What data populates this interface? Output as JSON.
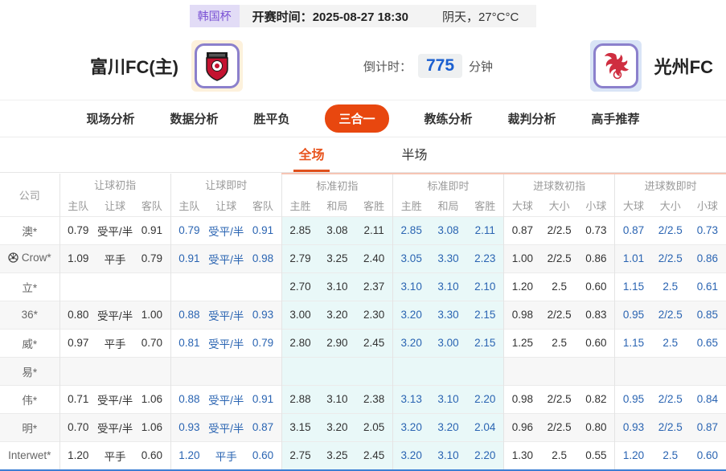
{
  "topbar": {
    "league": "韩国杯",
    "kickoff_label": "开赛时间：",
    "kickoff_time": "2025-08-27 18:30",
    "weather": "阴天，27°C°C"
  },
  "header": {
    "home_name": "富川FC(主)",
    "away_name": "光州FC",
    "countdown_label": "倒计时：",
    "countdown_value": "775",
    "countdown_unit": "分钟"
  },
  "nav": {
    "tabs": [
      {
        "label": "现场分析",
        "active": false
      },
      {
        "label": "数据分析",
        "active": false
      },
      {
        "label": "胜平负",
        "active": false
      },
      {
        "label": "三合一",
        "active": true
      },
      {
        "label": "教练分析",
        "active": false
      },
      {
        "label": "裁判分析",
        "active": false
      },
      {
        "label": "高手推荐",
        "active": false
      }
    ]
  },
  "subtabs": [
    {
      "label": "全场",
      "active": true
    },
    {
      "label": "半场",
      "active": false
    }
  ],
  "table": {
    "company_header": "公司",
    "groups": [
      {
        "title": "让球初指",
        "cols": [
          "主队",
          "让球",
          "客队"
        ],
        "live": false,
        "cyan": false,
        "hot": false
      },
      {
        "title": "让球即时",
        "cols": [
          "主队",
          "让球",
          "客队"
        ],
        "live": true,
        "cyan": false,
        "hot": false
      },
      {
        "title": "标准初指",
        "cols": [
          "主胜",
          "和局",
          "客胜"
        ],
        "live": false,
        "cyan": true,
        "hot": true
      },
      {
        "title": "标准即时",
        "cols": [
          "主胜",
          "和局",
          "客胜"
        ],
        "live": true,
        "cyan": true,
        "hot": true
      },
      {
        "title": "进球数初指",
        "cols": [
          "大球",
          "大小",
          "小球"
        ],
        "live": false,
        "cyan": false,
        "hot": true
      },
      {
        "title": "进球数即时",
        "cols": [
          "大球",
          "大小",
          "小球"
        ],
        "live": true,
        "cyan": false,
        "hot": true
      }
    ],
    "rows": [
      {
        "company": "澳*",
        "has_icon": false,
        "cells": [
          [
            "0.79",
            "受平/半",
            "0.91"
          ],
          [
            "0.79",
            "受平/半",
            "0.91"
          ],
          [
            "2.85",
            "3.08",
            "2.11"
          ],
          [
            "2.85",
            "3.08",
            "2.11"
          ],
          [
            "0.87",
            "2/2.5",
            "0.73"
          ],
          [
            "0.87",
            "2/2.5",
            "0.73"
          ]
        ]
      },
      {
        "company": "Crow*",
        "has_icon": true,
        "cells": [
          [
            "1.09",
            "平手",
            "0.79"
          ],
          [
            "0.91",
            "受平/半",
            "0.98"
          ],
          [
            "2.79",
            "3.25",
            "2.40"
          ],
          [
            "3.05",
            "3.30",
            "2.23"
          ],
          [
            "1.00",
            "2/2.5",
            "0.86"
          ],
          [
            "1.01",
            "2/2.5",
            "0.86"
          ]
        ]
      },
      {
        "company": "立*",
        "has_icon": false,
        "cells": [
          [
            "",
            "",
            ""
          ],
          [
            "",
            "",
            ""
          ],
          [
            "2.70",
            "3.10",
            "2.37"
          ],
          [
            "3.10",
            "3.10",
            "2.10"
          ],
          [
            "1.20",
            "2.5",
            "0.60"
          ],
          [
            "1.15",
            "2.5",
            "0.61"
          ]
        ]
      },
      {
        "company": "36*",
        "has_icon": false,
        "cells": [
          [
            "0.80",
            "受平/半",
            "1.00"
          ],
          [
            "0.88",
            "受平/半",
            "0.93"
          ],
          [
            "3.00",
            "3.20",
            "2.30"
          ],
          [
            "3.20",
            "3.30",
            "2.15"
          ],
          [
            "0.98",
            "2/2.5",
            "0.83"
          ],
          [
            "0.95",
            "2/2.5",
            "0.85"
          ]
        ]
      },
      {
        "company": "威*",
        "has_icon": false,
        "cells": [
          [
            "0.97",
            "平手",
            "0.70"
          ],
          [
            "0.81",
            "受平/半",
            "0.79"
          ],
          [
            "2.80",
            "2.90",
            "2.45"
          ],
          [
            "3.20",
            "3.00",
            "2.15"
          ],
          [
            "1.25",
            "2.5",
            "0.60"
          ],
          [
            "1.15",
            "2.5",
            "0.65"
          ]
        ]
      },
      {
        "company": "易*",
        "has_icon": false,
        "cells": [
          [
            "",
            "",
            ""
          ],
          [
            "",
            "",
            ""
          ],
          [
            "",
            "",
            ""
          ],
          [
            "",
            "",
            ""
          ],
          [
            "",
            "",
            ""
          ],
          [
            "",
            "",
            ""
          ]
        ]
      },
      {
        "company": "伟*",
        "has_icon": false,
        "cells": [
          [
            "0.71",
            "受平/半",
            "1.06"
          ],
          [
            "0.88",
            "受平/半",
            "0.91"
          ],
          [
            "2.88",
            "3.10",
            "2.38"
          ],
          [
            "3.13",
            "3.10",
            "2.20"
          ],
          [
            "0.98",
            "2/2.5",
            "0.82"
          ],
          [
            "0.95",
            "2/2.5",
            "0.84"
          ]
        ]
      },
      {
        "company": "明*",
        "has_icon": false,
        "cells": [
          [
            "0.70",
            "受平/半",
            "1.06"
          ],
          [
            "0.93",
            "受平/半",
            "0.87"
          ],
          [
            "3.15",
            "3.20",
            "2.05"
          ],
          [
            "3.20",
            "3.20",
            "2.04"
          ],
          [
            "0.96",
            "2/2.5",
            "0.80"
          ],
          [
            "0.93",
            "2/2.5",
            "0.87"
          ]
        ]
      },
      {
        "company": "Interwet*",
        "has_icon": false,
        "cells": [
          [
            "1.20",
            "平手",
            "0.60"
          ],
          [
            "1.20",
            "平手",
            "0.60"
          ],
          [
            "2.75",
            "3.25",
            "2.45"
          ],
          [
            "3.20",
            "3.10",
            "2.20"
          ],
          [
            "1.30",
            "2.5",
            "0.55"
          ],
          [
            "1.20",
            "2.5",
            "0.60"
          ]
        ]
      }
    ]
  },
  "colors": {
    "accent_orange": "#e8470f",
    "subtab_orange": "#e8541e",
    "live_blue": "#2a64b2",
    "countdown_blue": "#1b5fd0",
    "cyan_column_bg": "#e9f8f8",
    "alt_row_bg": "#f7f7f7",
    "league_badge_bg": "#e2dcf6",
    "league_badge_text": "#7a52d4"
  }
}
